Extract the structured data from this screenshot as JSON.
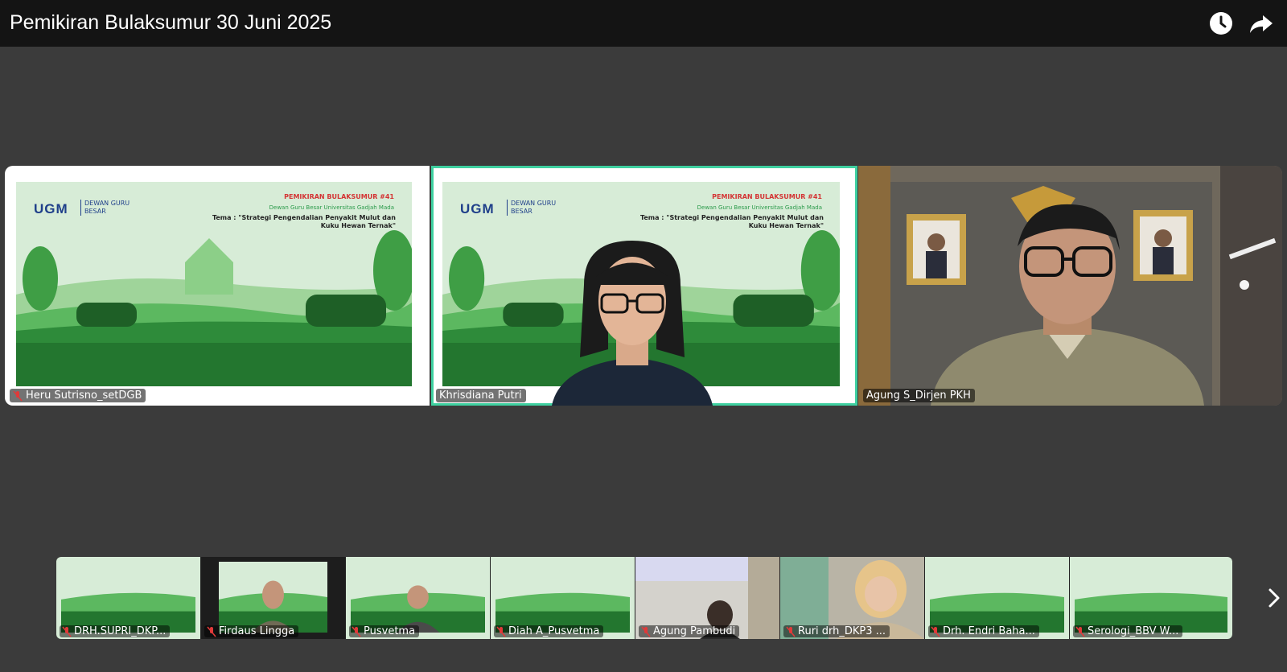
{
  "window": {
    "title": "Pemikiran Bulaksumur 30 Juni 2025"
  },
  "toolbar": {
    "clock_icon": "clock-icon",
    "share_icon": "share-icon"
  },
  "slide": {
    "logo": "UGM",
    "logo_sub": "DEWAN GURU BESAR",
    "header": "PEMIKIRAN BULAKSUMUR #41",
    "subheader": "Dewan Guru Besar Universitas Gadjah Mada",
    "theme": "Tema : \"Strategi Pengendalian Penyakit Mulut dan Kuku Hewan Ternak\""
  },
  "main_tiles": [
    {
      "name": "Heru Sutrisno_setDGB",
      "muted": true
    },
    {
      "name": "Khrisdiana Putri",
      "muted": false,
      "active_speaker": true
    },
    {
      "name": "Agung S_Dirjen PKH",
      "muted": false
    }
  ],
  "thumbnails": [
    {
      "name": "DRH.SUPRI_DKP..."
    },
    {
      "name": "Firdaus Lingga"
    },
    {
      "name": "Pusvetma"
    },
    {
      "name": "Diah A_Pusvetma"
    },
    {
      "name": "Agung Pambudi"
    },
    {
      "name": "Ruri drh_DKP3 ..."
    },
    {
      "name": "Drh. Endri Baha..."
    },
    {
      "name": "Serologi_BBV W..."
    }
  ],
  "colors": {
    "active_border": "#3fd0a0",
    "muted_icon": "#e03a3a",
    "slide_green": "#2e8b3a"
  }
}
